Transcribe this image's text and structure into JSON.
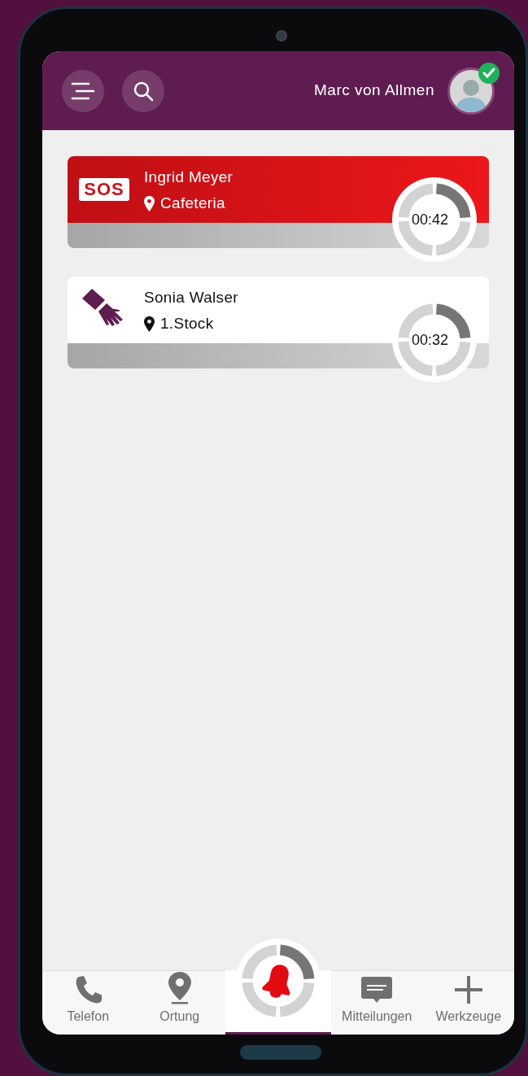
{
  "header": {
    "user_name": "Marc von Allmen",
    "user_online": true
  },
  "alarms": [
    {
      "kind": "sos",
      "badge": "SOS",
      "name": "Ingrid Meyer",
      "location": "Cafeteria",
      "timer": "00:42"
    },
    {
      "kind": "assist",
      "name": "Sonia Walser",
      "location": "1.Stock",
      "timer": "00:32"
    }
  ],
  "nav": [
    {
      "kind": "phone",
      "label": "Telefon",
      "selected": false
    },
    {
      "kind": "pin",
      "label": "Ortung",
      "selected": false
    },
    {
      "kind": "alarm",
      "selected": true
    },
    {
      "kind": "message",
      "label": "Mitteilungen",
      "selected": false
    },
    {
      "kind": "plus",
      "label": "Werkzeuge",
      "selected": false
    }
  ]
}
